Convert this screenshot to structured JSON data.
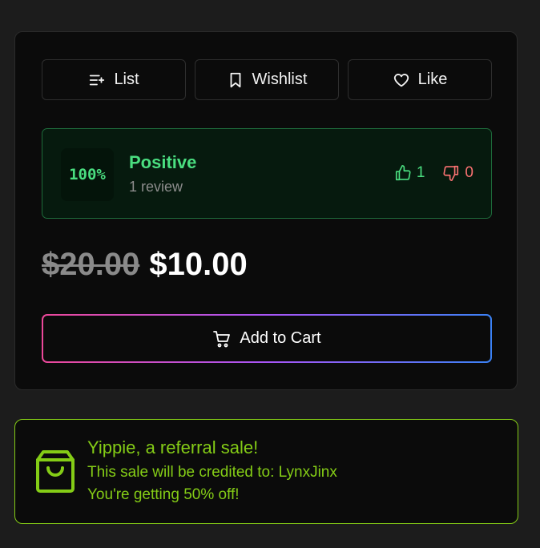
{
  "actions": {
    "list_label": "List",
    "wishlist_label": "Wishlist",
    "like_label": "Like"
  },
  "reviews": {
    "score": "100%",
    "rating_label": "Positive",
    "review_count": "1 review",
    "upvotes": "1",
    "downvotes": "0",
    "positive_color": "#4ade80",
    "negative_color": "#f87171"
  },
  "pricing": {
    "original_price": "$20.00",
    "sale_price": "$10.00"
  },
  "cart": {
    "label": "Add to Cart"
  },
  "referral": {
    "title": "Yippie, a referral sale!",
    "credit_line": "This sale will be credited to: LynxJinx",
    "discount_line": "You're getting 50% off!",
    "accent_color": "#84cc16"
  },
  "icons": {
    "list": "list-add-icon",
    "wishlist": "bookmark-icon",
    "like": "heart-icon",
    "upvote": "thumbs-up-icon",
    "downvote": "thumbs-down-icon",
    "cart": "cart-icon",
    "referral": "shopping-bag-icon"
  }
}
